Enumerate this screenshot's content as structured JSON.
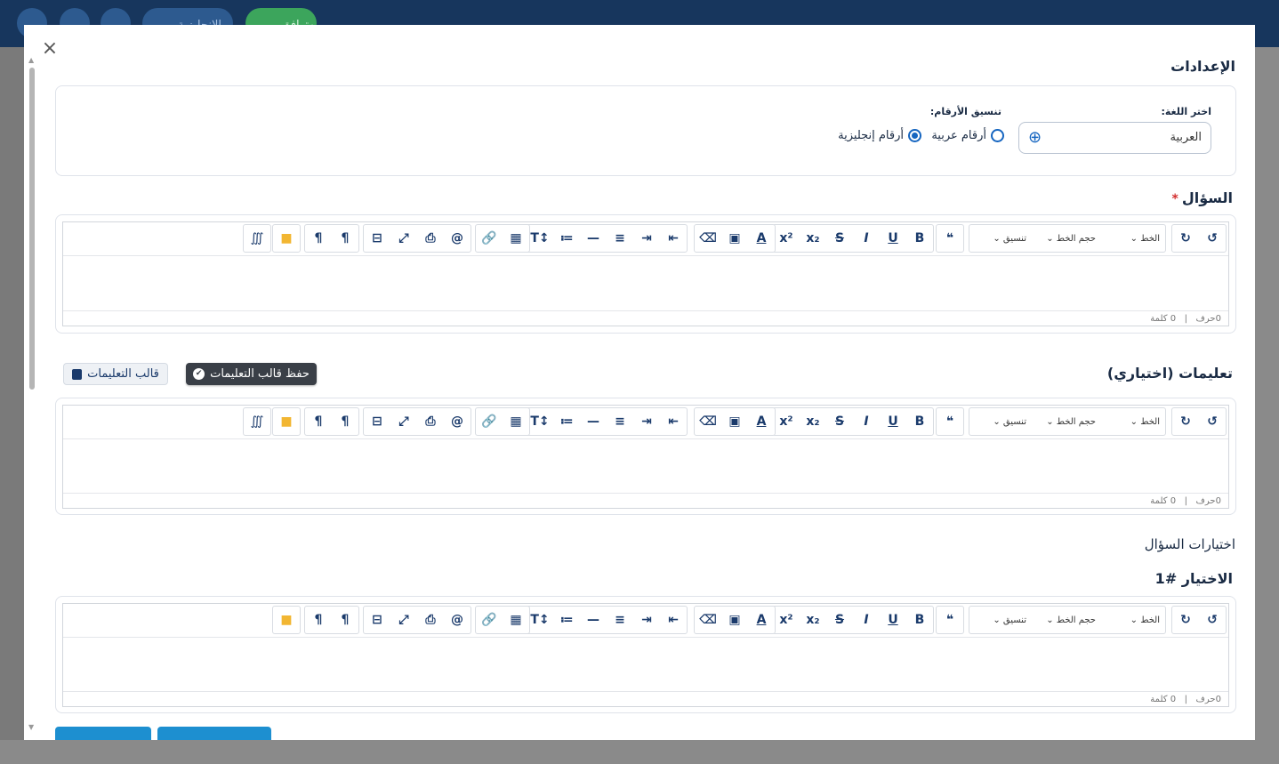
{
  "topbar": {
    "status_label": "متوافق",
    "language_label": "الإنجليزية"
  },
  "modal": {
    "settings_title": "الإعدادات",
    "language_label": "اختر اللغة:",
    "language_value": "العربية",
    "number_format_label": "تنسيق الأرقام:",
    "number_options": [
      {
        "label": "أرقام عربية",
        "selected": false
      },
      {
        "label": "أرقام إنجليزية",
        "selected": true
      }
    ],
    "question_title": "السؤال",
    "required_mark": "*",
    "instructions_title": "تعليمات (اختياري)",
    "save_template_label": "حفظ قالب التعليمات",
    "template_label": "قالب التعليمات",
    "choices_title": "اختيارات السؤال",
    "choice_title": "الاختيار #1",
    "editor": {
      "format_dropdown": "تنسيق",
      "font_size_dropdown": "حجم الخط",
      "font_dropdown": "الخط",
      "char_count": "0حرف",
      "word_count": "0 كلمة",
      "separator": "|"
    }
  },
  "colors": {
    "topbar": "#17365d",
    "accent": "#1565c0",
    "dark_button": "#3a3f47",
    "primary_button": "#1d8fd0"
  }
}
